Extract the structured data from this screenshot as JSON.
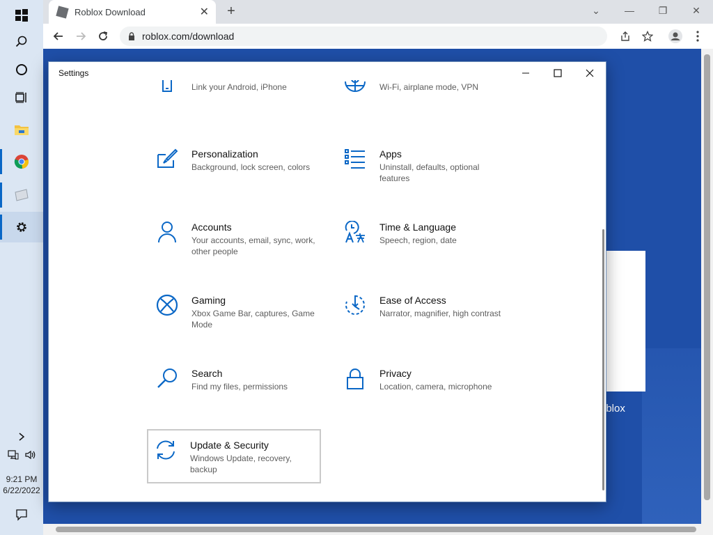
{
  "taskbar": {
    "clock_time": "9:21 PM",
    "clock_date": "6/22/2022"
  },
  "browser": {
    "tab_title": "Roblox Download",
    "url": "roblox.com/download",
    "page_text": "oblox"
  },
  "settings": {
    "title": "Settings",
    "items": [
      {
        "name": "",
        "desc": "Link your Android, iPhone",
        "icon": "phone-icon"
      },
      {
        "name": "",
        "desc": "Wi-Fi, airplane mode, VPN",
        "icon": "globe-icon"
      },
      {
        "name": "Personalization",
        "desc": "Background, lock screen, colors",
        "icon": "paintbrush-icon"
      },
      {
        "name": "Apps",
        "desc": "Uninstall, defaults, optional features",
        "icon": "apps-list-icon"
      },
      {
        "name": "Accounts",
        "desc": "Your accounts, email, sync, work, other people",
        "icon": "person-icon"
      },
      {
        "name": "Time & Language",
        "desc": "Speech, region, date",
        "icon": "time-language-icon"
      },
      {
        "name": "Gaming",
        "desc": "Xbox Game Bar, captures, Game Mode",
        "icon": "xbox-icon"
      },
      {
        "name": "Ease of Access",
        "desc": "Narrator, magnifier, high contrast",
        "icon": "ease-of-access-icon"
      },
      {
        "name": "Search",
        "desc": "Find my files, permissions",
        "icon": "search-icon"
      },
      {
        "name": "Privacy",
        "desc": "Location, camera, microphone",
        "icon": "lock-icon"
      },
      {
        "name": "Update & Security",
        "desc": "Windows Update, recovery, backup",
        "icon": "sync-icon"
      }
    ]
  },
  "colors": {
    "accent": "#0a67c6",
    "page_background": "#1f4fa8"
  }
}
